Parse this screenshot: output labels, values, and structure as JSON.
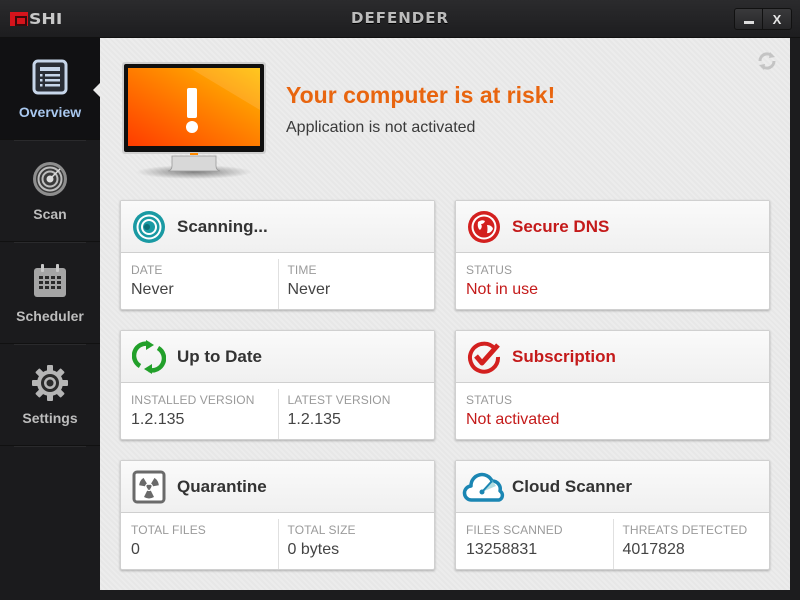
{
  "titlebar": {
    "logo_text": "SHI",
    "title": "DEFENDER",
    "minimize_label": "_",
    "close_label": "X"
  },
  "sidebar": {
    "items": [
      {
        "label": "Overview",
        "icon": "list-icon",
        "active": true
      },
      {
        "label": "Scan",
        "icon": "radar-icon",
        "active": false
      },
      {
        "label": "Scheduler",
        "icon": "calendar-icon",
        "active": false
      },
      {
        "label": "Settings",
        "icon": "gear-icon",
        "active": false
      }
    ]
  },
  "alert": {
    "title": "Your computer is at risk!",
    "subtitle": "Application is not activated",
    "title_color": "#e8650f"
  },
  "cards": {
    "scan": {
      "title": "Scanning...",
      "icon": "radar-icon",
      "fields": [
        {
          "label": "DATE",
          "value": "Never"
        },
        {
          "label": "TIME",
          "value": "Never"
        }
      ]
    },
    "dns": {
      "title": "Secure DNS",
      "icon": "globe-icon",
      "fields": [
        {
          "label": "STATUS",
          "value": "Not in use"
        }
      ]
    },
    "update": {
      "title": "Up to Date",
      "icon": "sync-icon",
      "fields": [
        {
          "label": "INSTALLED VERSION",
          "value": "1.2.135"
        },
        {
          "label": "LATEST VERSION",
          "value": "1.2.135"
        }
      ]
    },
    "subscription": {
      "title": "Subscription",
      "icon": "check-circle-icon",
      "fields": [
        {
          "label": "STATUS",
          "value": "Not activated"
        }
      ]
    },
    "quarantine": {
      "title": "Quarantine",
      "icon": "radiation-icon",
      "fields": [
        {
          "label": "TOTAL FILES",
          "value": "0"
        },
        {
          "label": "TOTAL SIZE",
          "value": "0 bytes"
        }
      ]
    },
    "cloud": {
      "title": "Cloud Scanner",
      "icon": "cloud-icon",
      "fields": [
        {
          "label": "FILES SCANNED",
          "value": "13258831"
        },
        {
          "label": "THREATS DETECTED",
          "value": "4017828"
        }
      ]
    }
  },
  "colors": {
    "alert_orange": "#e8650f",
    "danger_red": "#c41a1a",
    "teal": "#1a9aa3",
    "green": "#22a02a",
    "active_nav": "#a9c8ef"
  }
}
